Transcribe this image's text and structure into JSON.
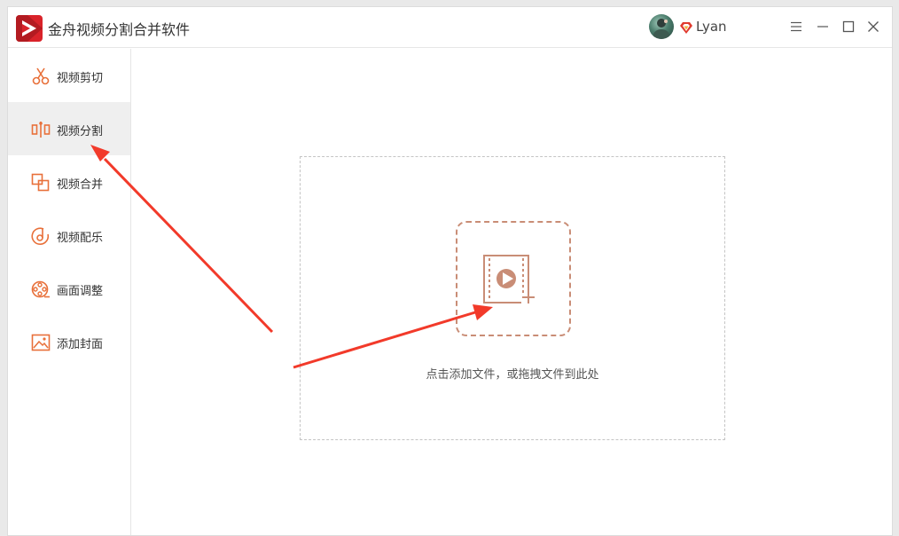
{
  "app": {
    "title": "金舟视频分割合并软件"
  },
  "user": {
    "name": "Lyan"
  },
  "sidebar": {
    "items": [
      {
        "label": "视频剪切",
        "icon": "scissors-icon"
      },
      {
        "label": "视频分割",
        "icon": "split-icon",
        "active": true
      },
      {
        "label": "视频合并",
        "icon": "merge-icon"
      },
      {
        "label": "视频配乐",
        "icon": "music-icon"
      },
      {
        "label": "画面调整",
        "icon": "film-reel-icon"
      },
      {
        "label": "添加封面",
        "icon": "image-icon"
      }
    ]
  },
  "main": {
    "drop_hint": "点击添加文件，或拖拽文件到此处"
  },
  "colors": {
    "accent": "#e8703a",
    "icon_brown": "#c98d76",
    "arrow": "#f23a2a",
    "brand_red": "#d9232a"
  }
}
